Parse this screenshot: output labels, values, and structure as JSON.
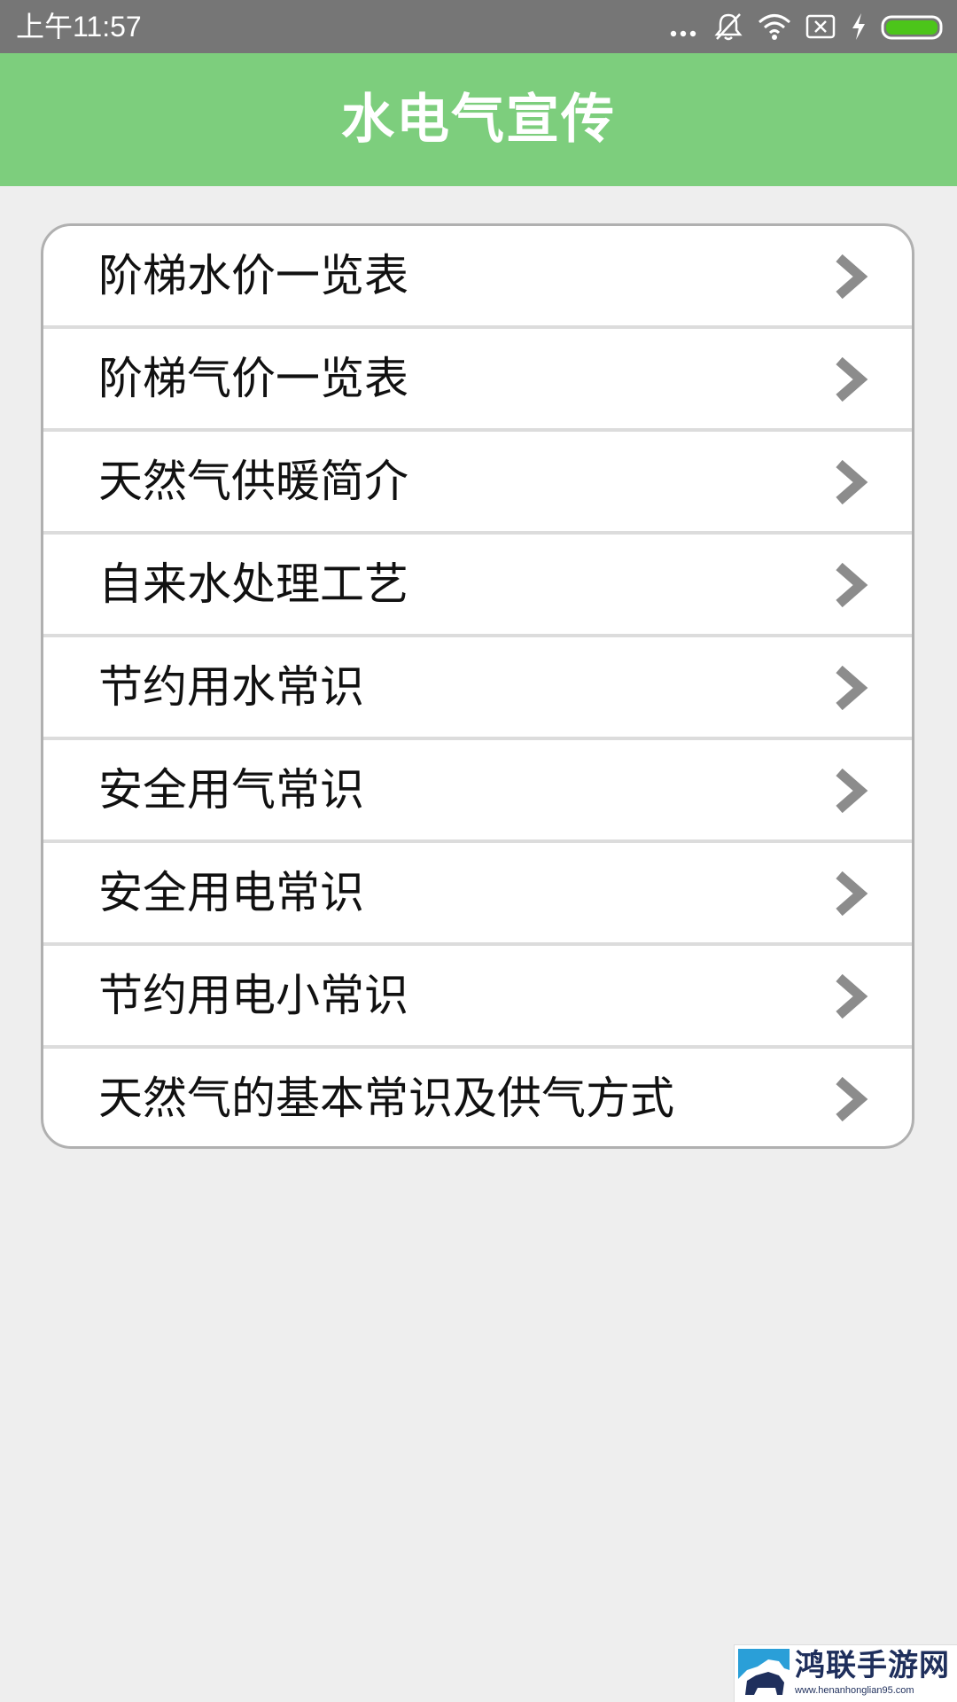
{
  "status_bar": {
    "time": "上午11:57",
    "icons": [
      "more-dots-icon",
      "vibrate-off-icon",
      "wifi-icon",
      "no-sim-icon",
      "charging-bolt-icon",
      "battery-icon"
    ],
    "battery_color": "#4cc51a"
  },
  "app_bar": {
    "title": "水电气宣传",
    "background": "#7dce7d"
  },
  "menu": {
    "items": [
      {
        "label": "阶梯水价一览表"
      },
      {
        "label": "阶梯气价一览表"
      },
      {
        "label": "天然气供暖简介"
      },
      {
        "label": "自来水处理工艺"
      },
      {
        "label": "节约用水常识"
      },
      {
        "label": "安全用气常识"
      },
      {
        "label": "安全用电常识"
      },
      {
        "label": "节约用电小常识"
      },
      {
        "label": "天然气的基本常识及供气方式"
      }
    ],
    "chevron_icon": "chevron-right-icon"
  },
  "watermark": {
    "name": "鸿联手游网",
    "url": "www.henanhonglian95.com",
    "logo_icon": "bison-logo-icon"
  }
}
